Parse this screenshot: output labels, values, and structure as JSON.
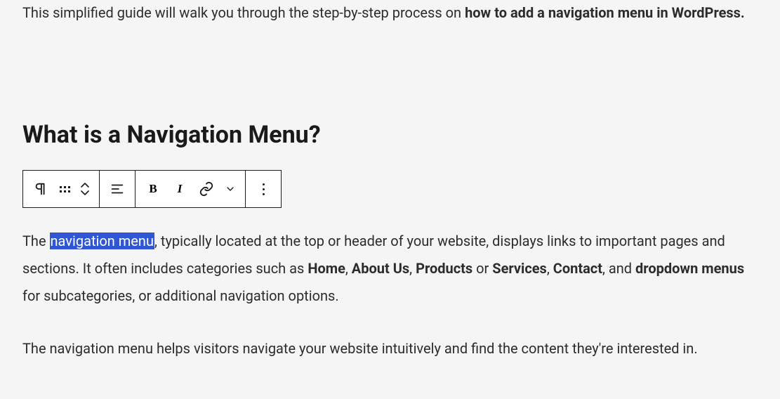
{
  "intro": {
    "part1": "This simplified guide will walk you through the step-by-step process on ",
    "bold": "how to add a navigation menu in WordPress.",
    "part2": ""
  },
  "heading": "What is a Navigation Menu?",
  "toolbar": {
    "paragraph_icon": "paragraph-icon",
    "drag_icon": "drag-handle-icon",
    "mover_icon": "move-up-down-icon",
    "align_icon": "align-left-icon",
    "bold_label": "B",
    "italic_label": "I",
    "link_icon": "link-icon",
    "dropdown_icon": "chevron-down-icon",
    "more_icon": "more-options-icon"
  },
  "para1": {
    "t1": "The ",
    "highlight": "navigation menu",
    "t2": ", typically located at the top or header of your website, displays links to important pages and sections. It often includes categories such as ",
    "b1": "Home",
    "c1": ", ",
    "b2": "About Us",
    "c2": ", ",
    "b3": "Products",
    "c3": " or ",
    "b4": "Services",
    "c4": ", ",
    "b5": "Contact",
    "c5": ", and ",
    "b6": "dropdown menus",
    "t3": " for subcategories, or additional navigation options."
  },
  "para2": "The navigation menu helps visitors navigate your website intuitively and find the content they're interested in."
}
